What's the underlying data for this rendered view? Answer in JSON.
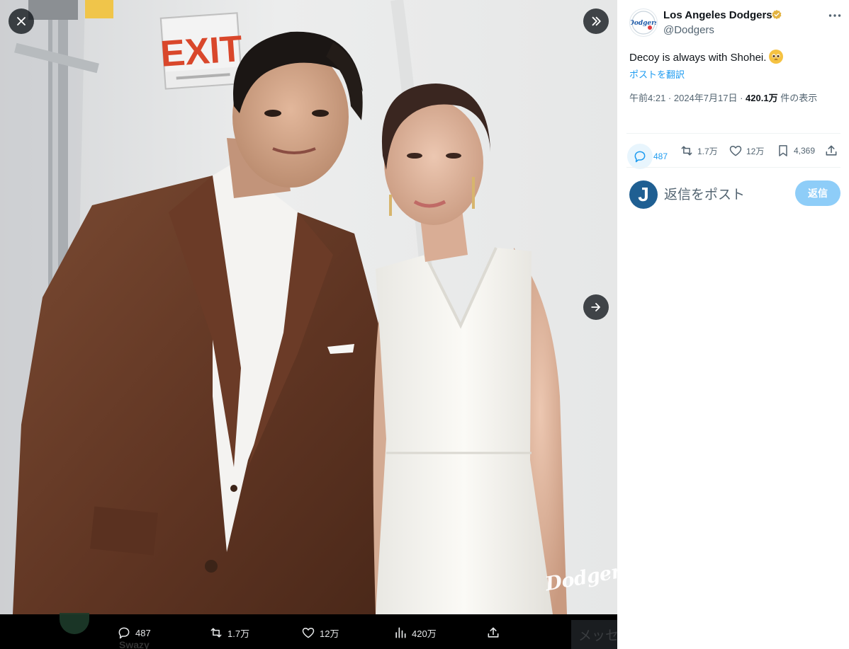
{
  "post": {
    "display_name": "Los Angeles Dodgers",
    "handle": "@Dodgers",
    "text": "Decoy is always with Shohei.",
    "translate_label": "ポストを翻訳",
    "time": "午前4:21 · 2024年7月17日 · ",
    "views_count": "420.1万",
    "views_label": " 件の表示",
    "stats": {
      "replies": "487",
      "reposts": "1.7万",
      "likes": "12万",
      "bookmarks": "4,369"
    },
    "verified_badge_color": "#e3b341",
    "accent_color": "#1d9bf0"
  },
  "reply_box": {
    "avatar_letter": "J",
    "placeholder": "返信をポスト",
    "button_label": "返信"
  },
  "media": {
    "exit_sign": "EXIT",
    "watermark": "Dodgers",
    "bar": {
      "replies": "487",
      "reposts": "1.7万",
      "likes": "12万",
      "views": "420万"
    },
    "peek_name": "Swazy",
    "peek_right": "メッセ"
  },
  "icons": [
    "close-icon",
    "expand-icon",
    "next-arrow-icon",
    "reply-icon",
    "repost-icon",
    "like-icon",
    "views-icon",
    "bookmark-icon",
    "share-icon",
    "more-icon",
    "verified-icon"
  ]
}
